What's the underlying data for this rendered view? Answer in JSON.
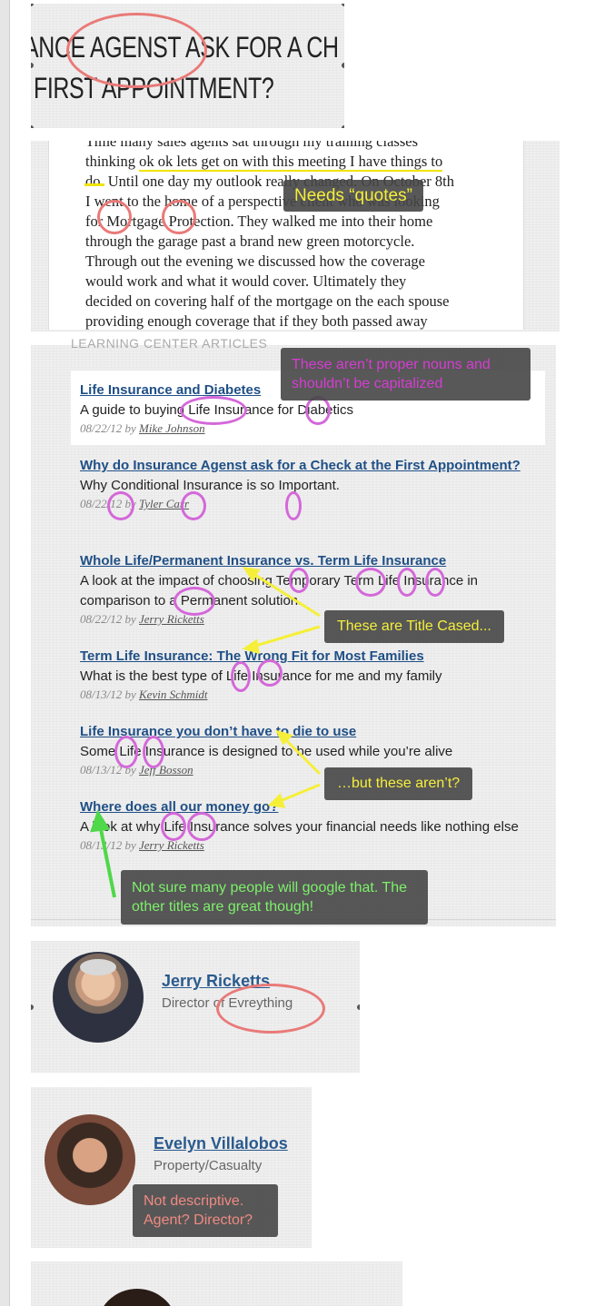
{
  "title": {
    "line1": "ANCE AGENST ASK FOR A CH",
    "line2": "FIRST APPOINTMENT?"
  },
  "article": {
    "lines": [
      "Time many sales agents sat through my training classes",
      "thinking ok ok lets get on with this meeting I have things to",
      "do. Until one day my outlook really changed. On October 8th",
      "I went to the home of a perspective client who was looking",
      "for Mortgage Protection. They walked me into their home",
      "through the garage past a brand new green motorcycle.",
      "Through out the evening we discussed how the coverage",
      "would work and what it would cover. Ultimately they",
      "decided on covering half of the mortgage on the each spouse",
      "providing enough coverage that if they both passed away"
    ],
    "highlight": "ok ok lets get on with this meeting I have things to"
  },
  "section_label": "LEARNING CENTER ARTICLES",
  "articles": [
    {
      "title": "Life Insurance and Diabetes",
      "desc": "A guide to buying Life Insurance for Diabetics",
      "date": "08/22/12",
      "by": "by",
      "author": "Mike Johnson"
    },
    {
      "title": "Why do Insurance Agenst ask for a Check at the First Appointment?",
      "desc": "Why Conditional Insurance is so Important.",
      "date": "08/22/12",
      "by": "by",
      "author": "Tyler Carr"
    },
    {
      "title": "Whole Life/Permanent Insurance vs. Term Life Insurance",
      "desc": "A look at the impact of choosing Temporary Term Life Insurance in comparison to a Permanent solution.",
      "date": "08/22/12",
      "by": "by",
      "author": "Jerry Ricketts"
    },
    {
      "title": "Term Life Insurance: The Wrong Fit for Most Families",
      "desc": "What is the best type of Life Insurance for me and my family",
      "date": "08/13/12",
      "by": "by",
      "author": "Kevin Schmidt"
    },
    {
      "title": "Life Insurance you don’t have to die to use",
      "desc": "Some Life Insurance is designed to be used while you’re alive",
      "date": "08/13/12",
      "by": "by",
      "author": "Jeff Bosson"
    },
    {
      "title": "Where does all our money go?",
      "desc": "A look at why Life Insurance solves your financial needs like nothing else",
      "date": "08/13/12",
      "by": "by",
      "author": "Jerry Ricketts"
    }
  ],
  "callouts": {
    "quotes": "Needs “quotes”",
    "proper_nouns": "These aren’t proper nouns and shouldn’t be capitalized",
    "title_cased": "These are Title Cased...",
    "but_not": "…but these aren’t?",
    "google": "Not sure many people will google that. The other titles are great though!",
    "not_descriptive": "Not descriptive. Agent? Director?"
  },
  "people": [
    {
      "name": "Jerry Ricketts",
      "role": "Director of Evreything"
    },
    {
      "name": "Evelyn Villalobos",
      "role": "Property/Casualty"
    }
  ],
  "colors": {
    "link": "#1f4f86",
    "yellow_callout_text": "#f5ef3a",
    "green_callout_text": "#7df06a",
    "magenta_callout_text": "#d63cd2",
    "salmon_callout_text": "#f08a82",
    "red_oval": "#e97a78",
    "pink_oval": "#d468d9"
  }
}
